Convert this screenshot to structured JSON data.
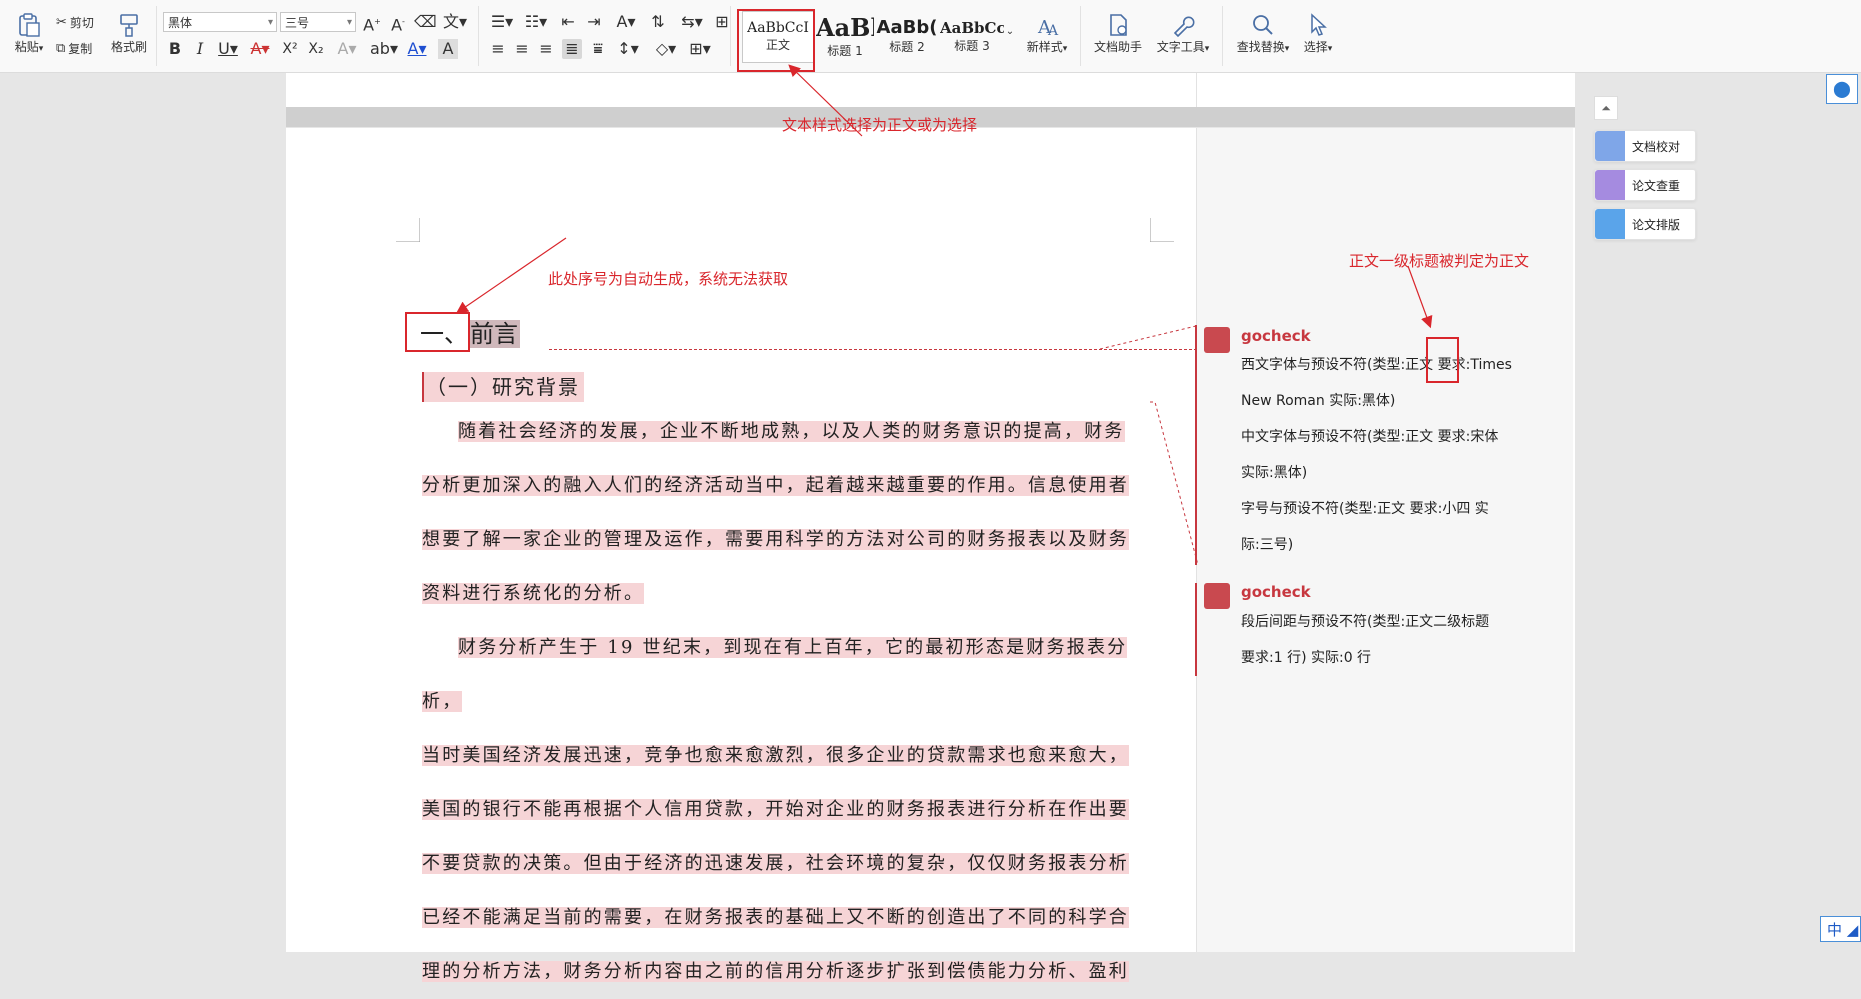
{
  "toolbar": {
    "paste": "粘贴",
    "cut": "剪切",
    "copy": "复制",
    "format_painter": "格式刷",
    "font_name": "黑体",
    "font_size": "三号",
    "styles": [
      {
        "sample": "AaBbCcI",
        "label": "正文"
      },
      {
        "sample": "AaBl",
        "label": "标题 1"
      },
      {
        "sample": "AaBb(",
        "label": "标题 2"
      },
      {
        "sample": "AaBbCcI",
        "label": "标题 3"
      }
    ],
    "new_style": "新样式",
    "doc_assistant": "文档助手",
    "text_tools": "文字工具",
    "find_replace": "查找替换",
    "select": "选择"
  },
  "annotations": {
    "style_note": "文本样式选择为正文或为选择",
    "auto_number_note": "此处序号为自动生成，系统无法获取",
    "heading_note": "正文一级标题被判定为正文"
  },
  "document": {
    "heading1_number": "一、",
    "heading1_text": "前言",
    "heading2": "（一）研究背景",
    "para1_lines": [
      "随着社会经济的发展，企业不断地成熟，以及人类的财务意识的提高，财务",
      "分析更加深入的融入人们的经济活动当中，起着越来越重要的作用。信息使用者",
      "想要了解一家企业的管理及运作，需要用科学的方法对公司的财务报表以及财务",
      "资料进行系统化的分析。"
    ],
    "para2_lines": [
      "财务分析产生于 19 世纪末，到现在有上百年，它的最初形态是财务报表分析，",
      "当时美国经济发展迅速，竞争也愈来愈激烈，很多企业的贷款需求也愈来愈大，",
      "美国的银行不能再根据个人信用贷款，开始对企业的财务报表进行分析在作出要",
      "不要贷款的决策。但由于经济的迅速发展，社会环境的复杂，仅仅财务报表分析",
      "已经不能满足当前的需要，在财务报表的基础上又不断的创造出了不同的科学合",
      "理的分析方法，财务分析内容由之前的信用分析逐步扩张到偿债能力分析、盈利"
    ]
  },
  "comments": [
    {
      "author": "gocheck",
      "lines": [
        "西文字体与预设不符(类型:正文    要求:Times",
        "New Roman    实际:黑体)",
        "中文字体与预设不符(类型:正文    要求:宋体",
        "实际:黑体)",
        "字号与预设不符(类型:正文    要求:小四    实",
        "际:三号)"
      ]
    },
    {
      "author": "gocheck",
      "lines": [
        "段后间距与预设不符(类型:正文二级标题",
        "要求:1 行)    实际:0 行"
      ]
    }
  ],
  "side_panel": {
    "buttons": [
      "文档校对",
      "论文查重",
      "论文排版"
    ]
  },
  "ime_label": "中"
}
